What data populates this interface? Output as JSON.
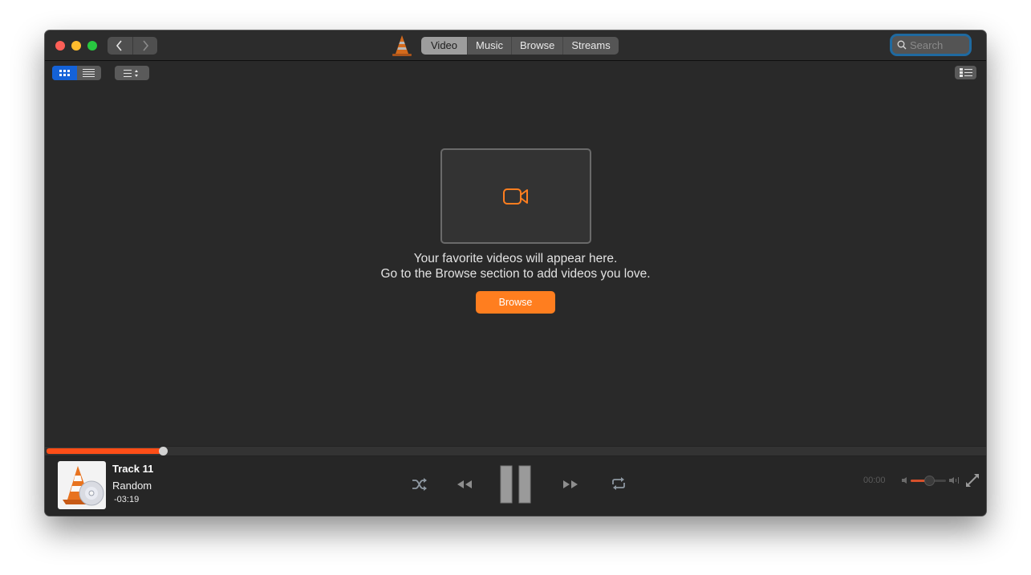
{
  "window": {
    "nav": {
      "back": "back",
      "forward": "forward"
    },
    "tabs": [
      {
        "label": "Video",
        "active": true
      },
      {
        "label": "Music",
        "active": false
      },
      {
        "label": "Browse",
        "active": false
      },
      {
        "label": "Streams",
        "active": false
      }
    ],
    "search": {
      "placeholder": "Search",
      "value": ""
    }
  },
  "toolbar": {
    "view_modes": [
      "grid",
      "list"
    ],
    "active_view": "grid"
  },
  "empty_state": {
    "icon": "video-camera-icon",
    "line1": "Your favorite videos will appear here.",
    "line2": "Go to the Browse section to add videos you love.",
    "button_label": "Browse"
  },
  "player": {
    "progress_fraction": 0.124,
    "track_title": "Track 11",
    "artist": "Random",
    "remaining_time": "-03:19",
    "elapsed_time": "00:00",
    "volume_fraction": 0.52,
    "state": "playing"
  },
  "colors": {
    "accent": "#ff7e1f",
    "progress": "#ff4e17",
    "selection": "#1462d8",
    "search_focus": "#1f6aa0"
  }
}
